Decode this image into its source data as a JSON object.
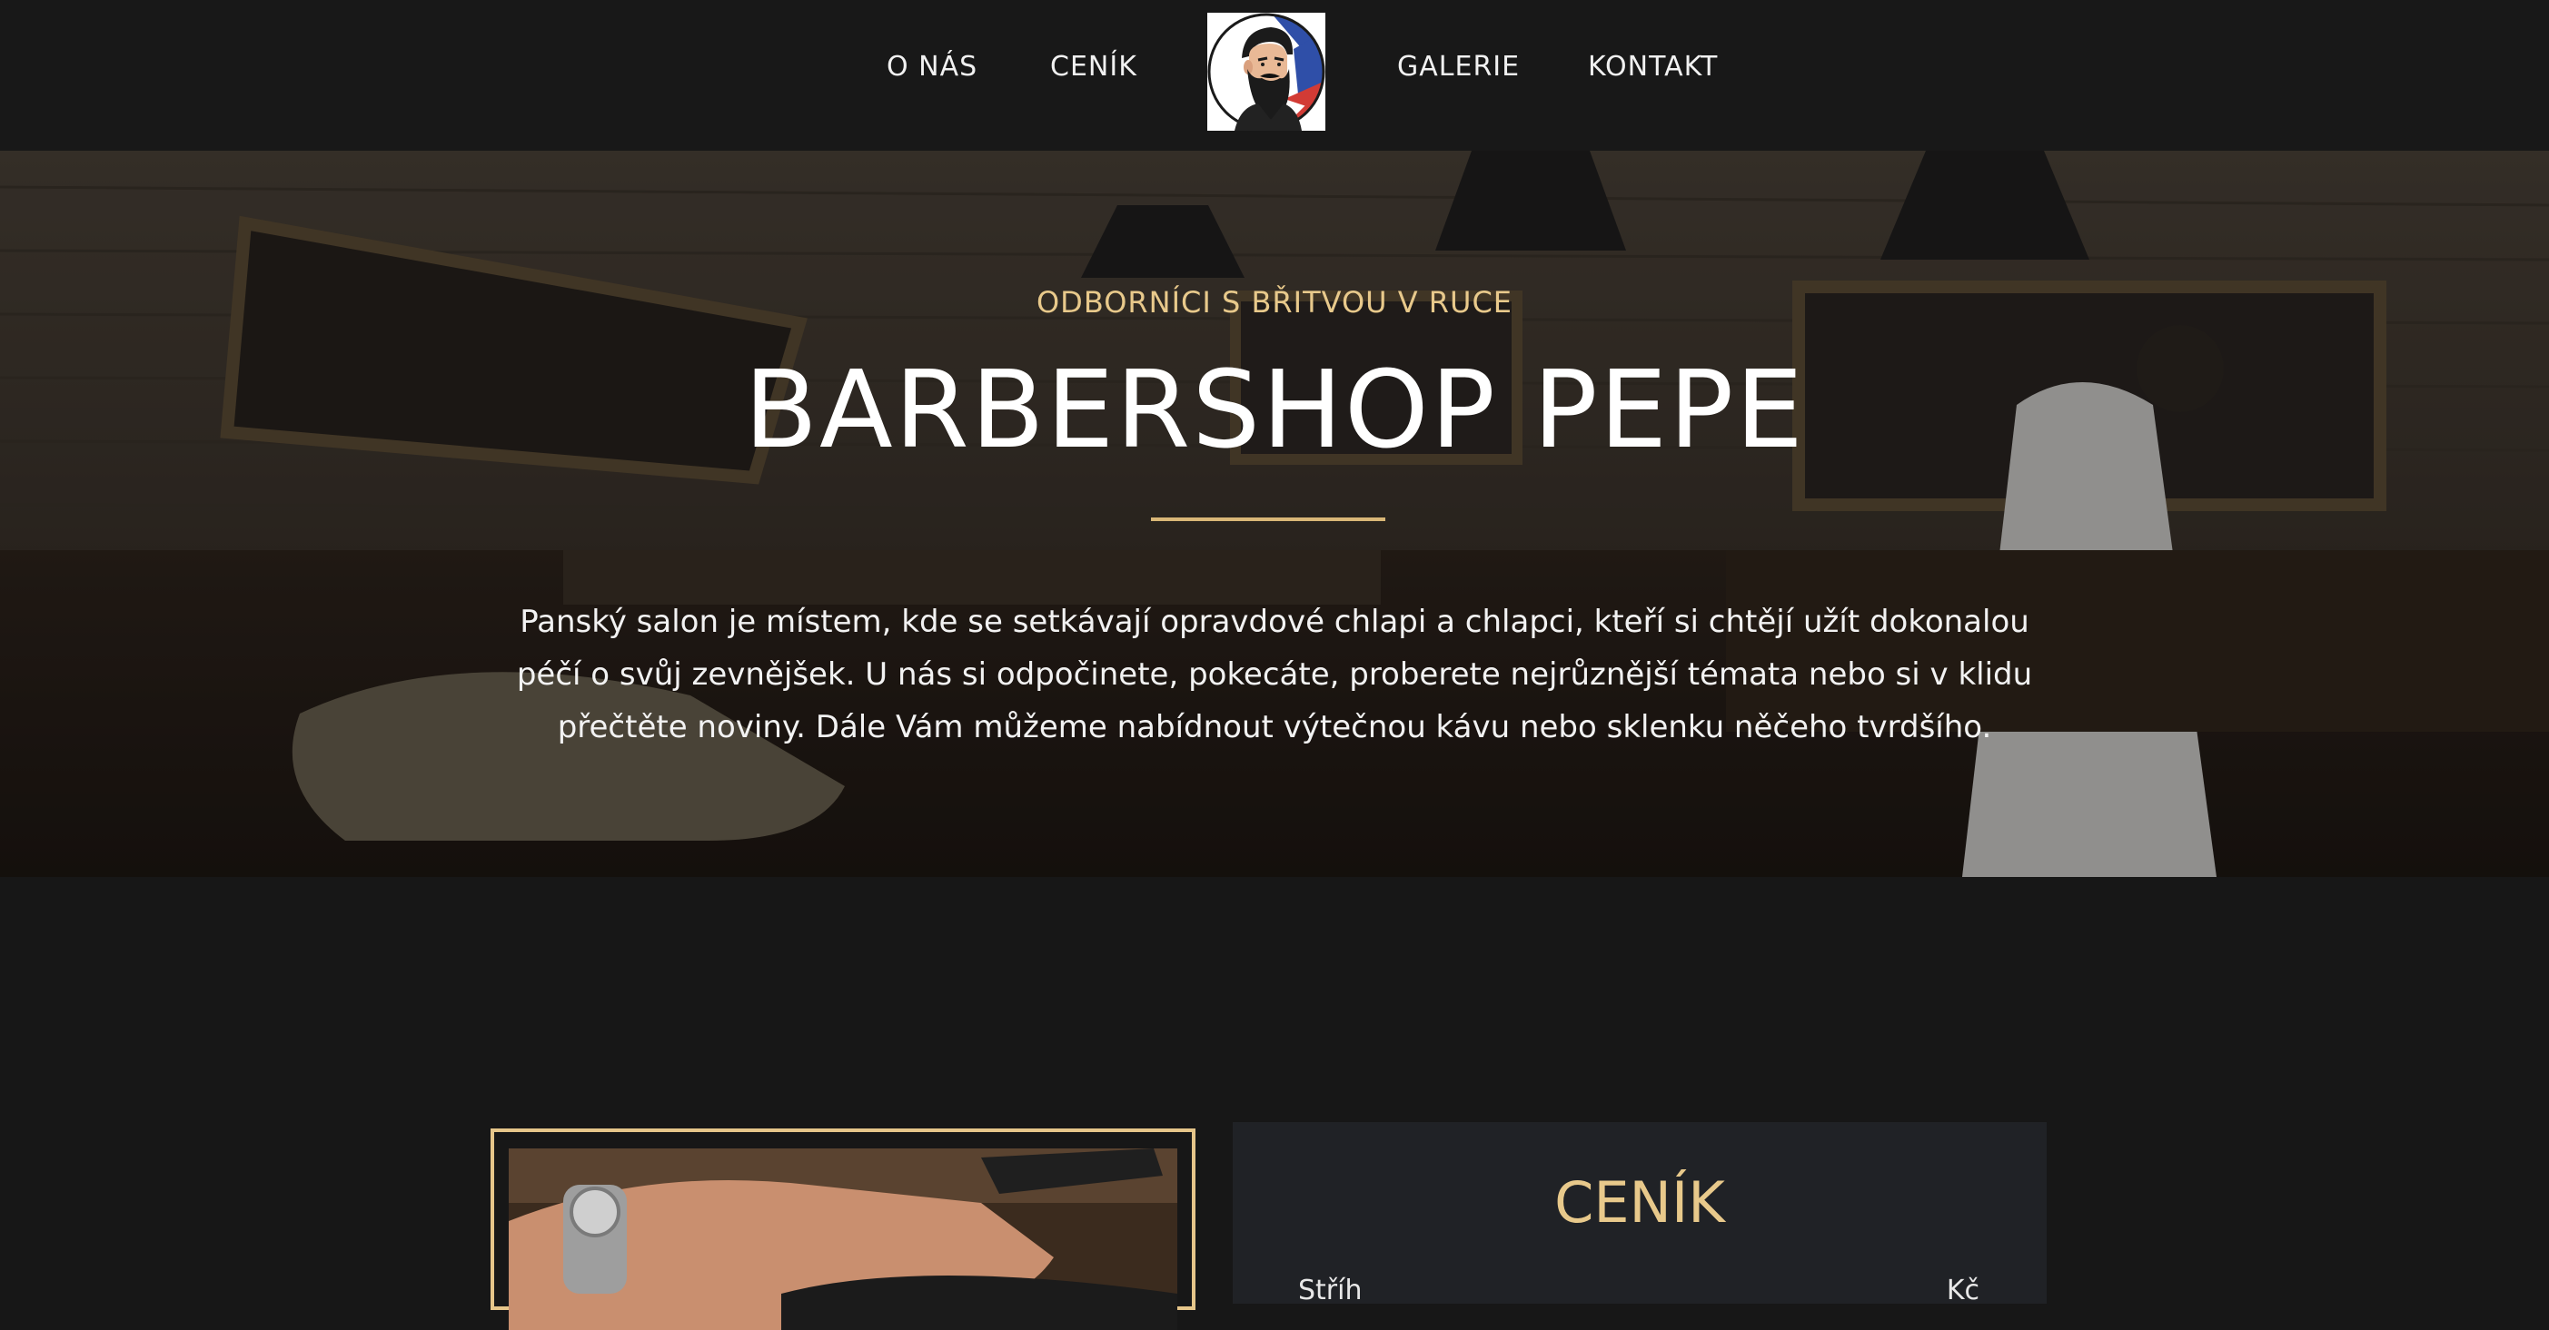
{
  "nav": {
    "items": [
      {
        "label": "O NÁS"
      },
      {
        "label": "CENÍK"
      },
      {
        "label": "GALERIE"
      },
      {
        "label": "KONTAKT"
      }
    ],
    "logo_icon": "bearded-barber-logo-icon"
  },
  "hero": {
    "kicker": "ODBORNÍCI S BŘITVOU V RUCE",
    "title": "BARBERSHOP PEPE",
    "text": "Panský salon je místem, kde se setkávají opravdové chlapi a chlapci, kteří si chtějí užít dokonalou péčí o svůj zevnějšek. U nás si odpočinete, pokecáte, proberete nejrůznější témata nebo si v klidu přečtěte noviny. Dále Vám můžeme nabídnout výtečnou kávu nebo sklenku něčeho tvrdšího."
  },
  "pricing": {
    "title": "CENÍK",
    "first_item_name": "Stříh",
    "first_item_price": "Kč"
  },
  "colors": {
    "background": "#171717",
    "accent_gold": "#e8c98b",
    "card_bg": "#202226"
  }
}
